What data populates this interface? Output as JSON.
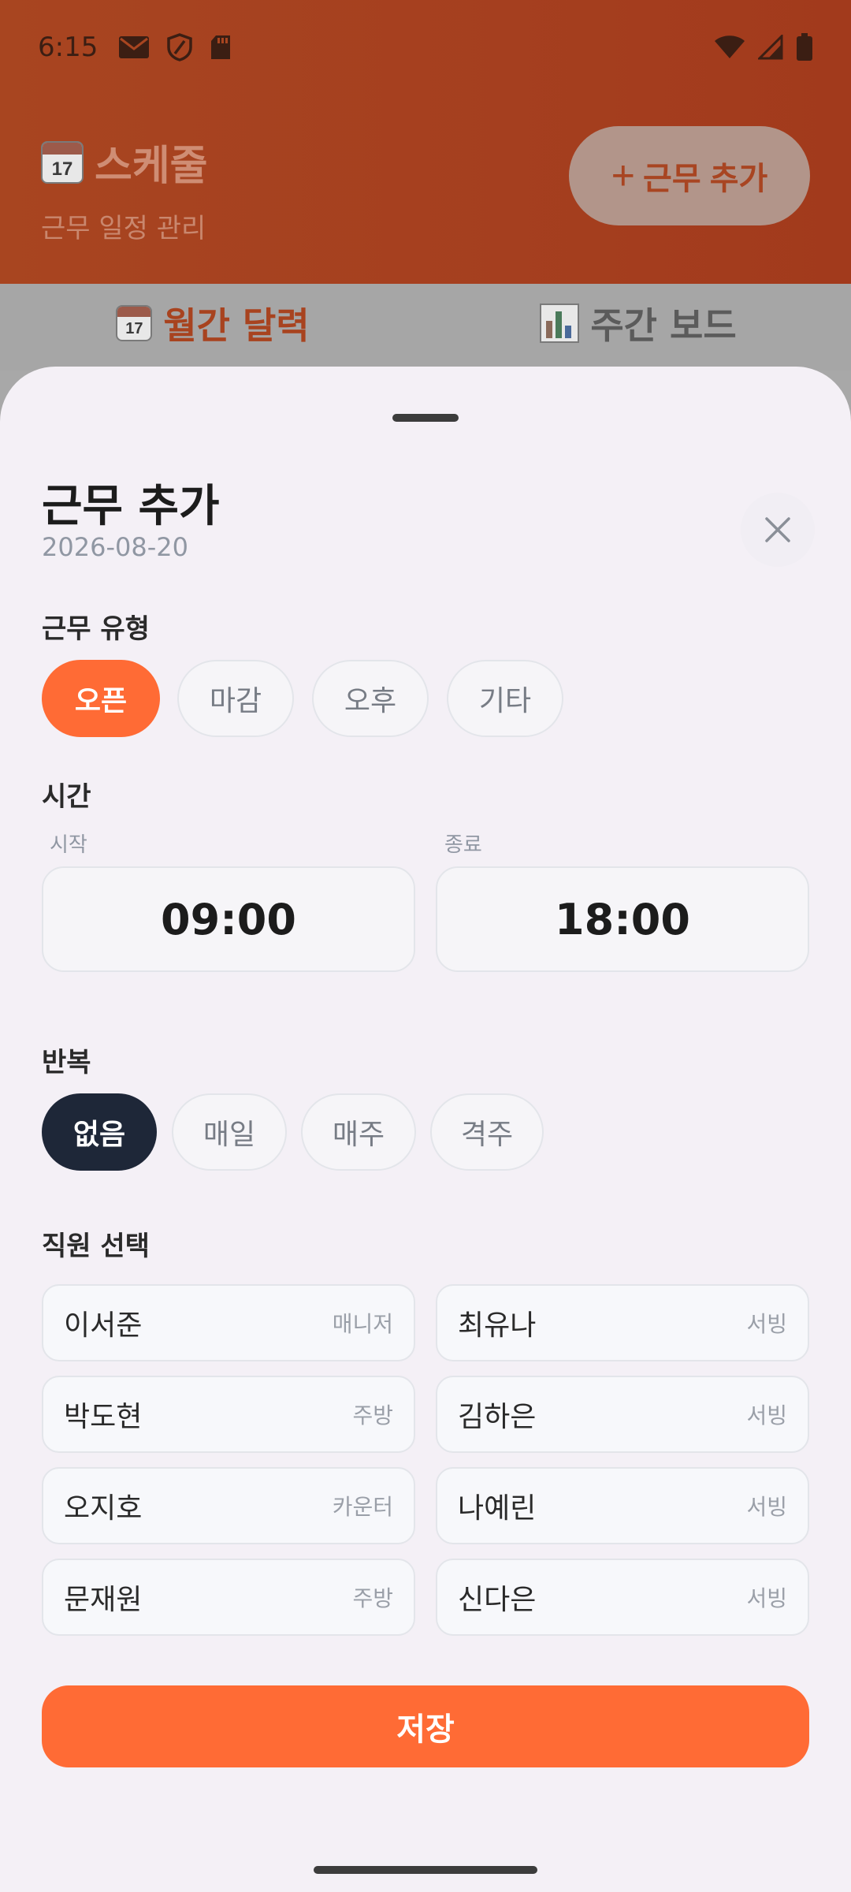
{
  "status": {
    "time": "6:15"
  },
  "header": {
    "title": "스케줄",
    "calendar_icon_number": "17",
    "subtitle": "근무 일정 관리",
    "add_button_label": "근무 추가",
    "add_button_symbol": "+"
  },
  "tabs": [
    {
      "label": "월간 달력",
      "icon": "calendar-emoji-icon",
      "active": true
    },
    {
      "label": "주간 보드",
      "icon": "bar-chart-emoji-icon",
      "active": false
    }
  ],
  "sheet": {
    "title": "근무 추가",
    "date": "2026-08-20",
    "shift_type": {
      "label": "근무 유형",
      "options": [
        "오픈",
        "마감",
        "오후",
        "기타"
      ],
      "selected": "오픈"
    },
    "time": {
      "label": "시간",
      "start_label": "시작",
      "start_value": "09:00",
      "end_label": "종료",
      "end_value": "18:00"
    },
    "repeat": {
      "label": "반복",
      "options": [
        "없음",
        "매일",
        "매주",
        "격주"
      ],
      "selected": "없음"
    },
    "staff": {
      "label": "직원 선택",
      "members": [
        {
          "name": "이서준",
          "role": "매니저"
        },
        {
          "name": "최유나",
          "role": "서빙"
        },
        {
          "name": "박도현",
          "role": "주방"
        },
        {
          "name": "김하은",
          "role": "서빙"
        },
        {
          "name": "오지호",
          "role": "카운터"
        },
        {
          "name": "나예린",
          "role": "서빙"
        },
        {
          "name": "문재원",
          "role": "주방"
        },
        {
          "name": "신다은",
          "role": "서빙"
        }
      ]
    },
    "save_label": "저장"
  },
  "colors": {
    "accent": "#ff6b35",
    "navy": "#1e2738",
    "header_bg": "#a84520"
  }
}
